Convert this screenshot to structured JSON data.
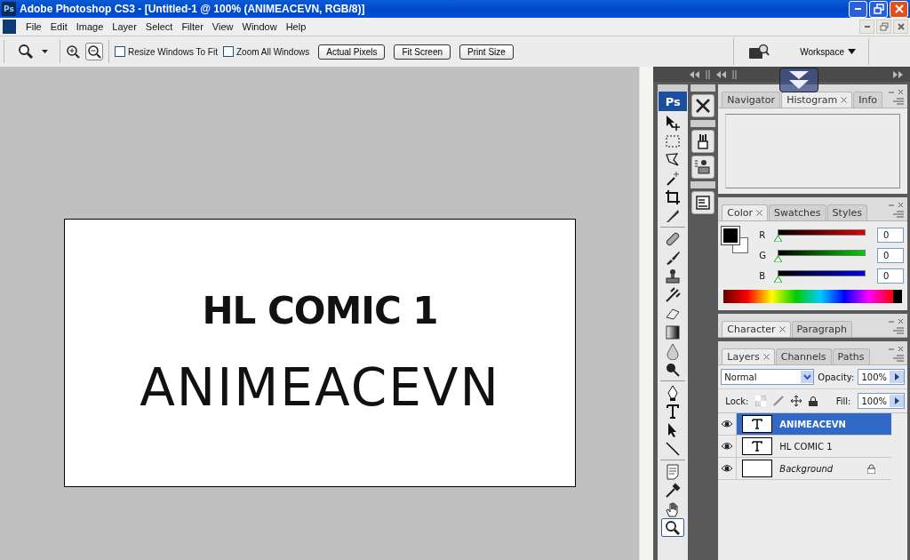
{
  "window": {
    "title": "Adobe Photoshop CS3 - [Untitled-1 @ 100% (ANIMEACEVN, RGB/8)]",
    "logo": "Ps"
  },
  "menu": [
    "File",
    "Edit",
    "Image",
    "Layer",
    "Select",
    "Filter",
    "View",
    "Window",
    "Help"
  ],
  "options_bar": {
    "checkboxes": [
      {
        "label": "Resize Windows To Fit",
        "checked": false
      },
      {
        "label": "Zoom All Windows",
        "checked": false
      }
    ],
    "buttons": [
      "Actual Pixels",
      "Fit Screen",
      "Print Size"
    ],
    "workspace": "Workspace"
  },
  "document": {
    "lines": [
      "HL COMIC 1",
      "ANIMEACEVN"
    ]
  },
  "toolbox": {
    "logo": "Ps",
    "tools": [
      {
        "kind": "move",
        "selected": false
      },
      {
        "kind": "marquee",
        "selected": false
      },
      {
        "kind": "lasso",
        "selected": false
      },
      {
        "kind": "wand",
        "selected": false
      },
      {
        "kind": "crop",
        "selected": false
      },
      {
        "kind": "slice",
        "selected": false
      },
      {
        "kind": "sep"
      },
      {
        "kind": "bandage",
        "selected": false
      },
      {
        "kind": "brush",
        "selected": false
      },
      {
        "kind": "stamp",
        "selected": false
      },
      {
        "kind": "history",
        "selected": false
      },
      {
        "kind": "eraser",
        "selected": false
      },
      {
        "kind": "gradient",
        "selected": false
      },
      {
        "kind": "blur",
        "selected": false
      },
      {
        "kind": "dodge",
        "selected": false
      },
      {
        "kind": "sep"
      },
      {
        "kind": "pen",
        "selected": false
      },
      {
        "kind": "type",
        "selected": false
      },
      {
        "kind": "select",
        "selected": false
      },
      {
        "kind": "line",
        "selected": false
      },
      {
        "kind": "sep"
      },
      {
        "kind": "notes",
        "selected": false
      },
      {
        "kind": "eyedropper",
        "selected": false
      },
      {
        "kind": "hand",
        "selected": false
      },
      {
        "kind": "zoom",
        "selected": true
      }
    ]
  },
  "navigator_panel": {
    "tabs": [
      {
        "label": "Navigator",
        "selected": false
      },
      {
        "label": "Histogram",
        "selected": true
      },
      {
        "label": "Info",
        "selected": false
      }
    ]
  },
  "color_panel": {
    "tabs": [
      {
        "label": "Color",
        "selected": true
      },
      {
        "label": "Swatches",
        "selected": false
      },
      {
        "label": "Styles",
        "selected": false
      }
    ],
    "channels": [
      {
        "name": "R",
        "level": 0,
        "value": "0"
      },
      {
        "name": "G",
        "level": 0,
        "value": "0"
      },
      {
        "name": "B",
        "level": 0,
        "value": "0"
      }
    ]
  },
  "character_panel": {
    "tabs": [
      {
        "label": "Character",
        "selected": true
      },
      {
        "label": "Paragraph",
        "selected": false
      }
    ]
  },
  "layers_panel": {
    "tabs": [
      {
        "label": "Layers",
        "selected": true
      },
      {
        "label": "Channels",
        "selected": false
      },
      {
        "label": "Paths",
        "selected": false
      }
    ],
    "blend_mode": "Normal",
    "opacity_label": "Opacity:",
    "opacity": "100%",
    "lock_label": "Lock:",
    "fill_label": "Fill:",
    "fill": "100%",
    "layers": [
      {
        "name": "ANIMEACEVN",
        "kind": "text",
        "visible": true,
        "selected": true,
        "locked": false
      },
      {
        "name": "HL COMIC 1",
        "kind": "text",
        "visible": true,
        "selected": false,
        "locked": false
      },
      {
        "name": "Background",
        "kind": "background",
        "visible": true,
        "selected": false,
        "locked": true
      }
    ]
  }
}
